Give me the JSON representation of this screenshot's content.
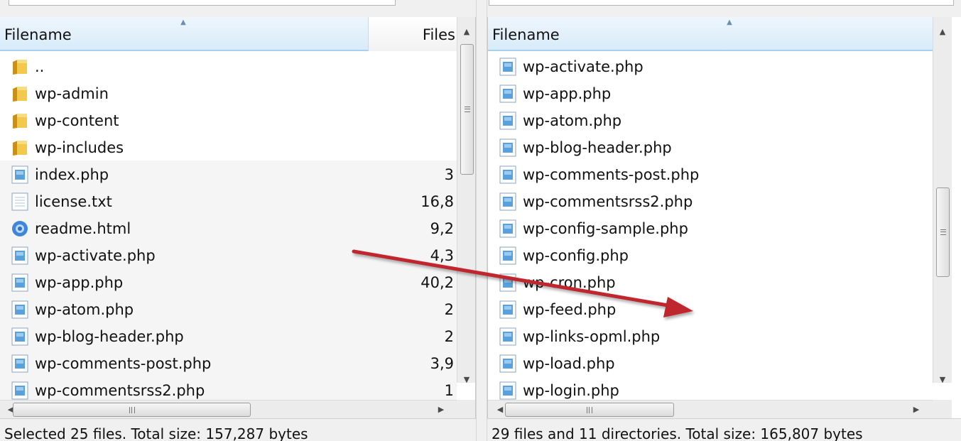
{
  "left_pane": {
    "columns": {
      "filename": "Filename",
      "filesize": "Files"
    },
    "rows": [
      {
        "icon": "folder-icon",
        "name": "..",
        "size": ""
      },
      {
        "icon": "folder-icon",
        "name": "wp-admin",
        "size": ""
      },
      {
        "icon": "folder-icon",
        "name": "wp-content",
        "size": ""
      },
      {
        "icon": "folder-icon",
        "name": "wp-includes",
        "size": ""
      },
      {
        "icon": "php-file-icon",
        "name": "index.php",
        "size": "3"
      },
      {
        "icon": "text-file-icon",
        "name": "license.txt",
        "size": "16,8"
      },
      {
        "icon": "html-file-icon",
        "name": "readme.html",
        "size": "9,2"
      },
      {
        "icon": "php-file-icon",
        "name": "wp-activate.php",
        "size": "4,3"
      },
      {
        "icon": "php-file-icon",
        "name": "wp-app.php",
        "size": "40,2"
      },
      {
        "icon": "php-file-icon",
        "name": "wp-atom.php",
        "size": "2"
      },
      {
        "icon": "php-file-icon",
        "name": "wp-blog-header.php",
        "size": "2"
      },
      {
        "icon": "php-file-icon",
        "name": "wp-comments-post.php",
        "size": "3,9"
      },
      {
        "icon": "php-file-icon",
        "name": "wp-commentsrss2.php",
        "size": "1"
      }
    ],
    "status": "Selected 25 files. Total size: 157,287 bytes"
  },
  "right_pane": {
    "columns": {
      "filename": "Filename"
    },
    "rows": [
      {
        "icon": "php-file-icon",
        "name": "wp-activate.php"
      },
      {
        "icon": "php-file-icon",
        "name": "wp-app.php"
      },
      {
        "icon": "php-file-icon",
        "name": "wp-atom.php"
      },
      {
        "icon": "php-file-icon",
        "name": "wp-blog-header.php"
      },
      {
        "icon": "php-file-icon",
        "name": "wp-comments-post.php"
      },
      {
        "icon": "php-file-icon",
        "name": "wp-commentsrss2.php"
      },
      {
        "icon": "php-file-icon",
        "name": "wp-config-sample.php"
      },
      {
        "icon": "php-file-icon",
        "name": "wp-config.php"
      },
      {
        "icon": "php-file-icon",
        "name": "wp-cron.php"
      },
      {
        "icon": "php-file-icon",
        "name": "wp-feed.php"
      },
      {
        "icon": "php-file-icon",
        "name": "wp-links-opml.php"
      },
      {
        "icon": "php-file-icon",
        "name": "wp-load.php"
      },
      {
        "icon": "php-file-icon",
        "name": "wp-login.php"
      }
    ],
    "status": "29 files and 11 directories. Total size: 165,807 bytes"
  },
  "colors": {
    "header_highlight": "#d8ebf9",
    "selection_row": "#f5f5f5",
    "drag_arrow": "#c0272d",
    "folder": "#e8b93a"
  }
}
